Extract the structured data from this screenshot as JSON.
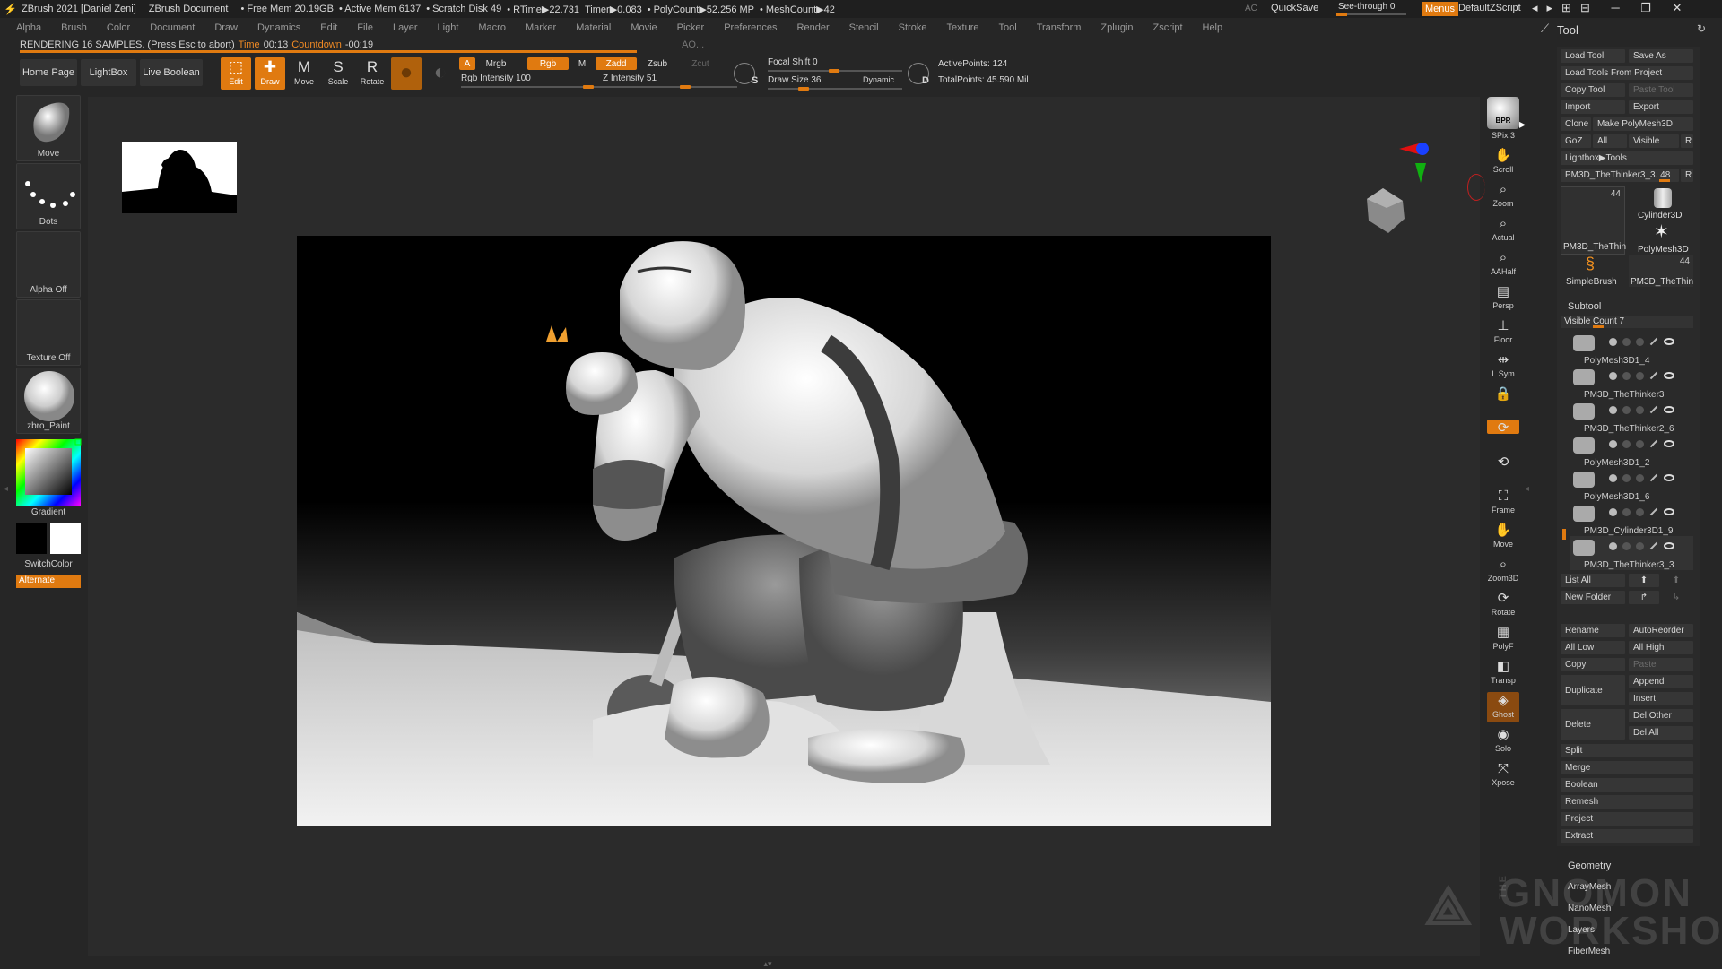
{
  "titlebar": {
    "app": "ZBrush 2021 [Daniel Zeni]",
    "document": "ZBrush Document",
    "free_mem": "• Free Mem 20.19GB",
    "active_mem": "• Active Mem 6137",
    "scratch": "• Scratch Disk 49",
    "rtime": "• RTime▶22.731",
    "timer": "Timer▶0.083",
    "polycount": "• PolyCount▶52.256 MP",
    "meshcount": "• MeshCount▶42",
    "ac": "AC",
    "quicksave": "QuickSave",
    "seethrough": "See-through  0",
    "menus": "Menus",
    "script": "DefaultZScript"
  },
  "menubar": [
    "Alpha",
    "Brush",
    "Color",
    "Document",
    "Draw",
    "Dynamics",
    "Edit",
    "File",
    "Layer",
    "Light",
    "Macro",
    "Marker",
    "Material",
    "Movie",
    "Picker",
    "Preferences",
    "Render",
    "Stencil",
    "Stroke",
    "Texture",
    "Tool",
    "Transform",
    "Zplugin",
    "Zscript",
    "Help"
  ],
  "status": {
    "rendering": "RENDERING 16 SAMPLES. (Press Esc to abort)",
    "time_label": "Time",
    "time": "00:13",
    "countdown_label": "Countdown",
    "countdown": "-00:19",
    "ao": "AO..."
  },
  "toolbar": {
    "home": "Home Page",
    "lightbox": "LightBox",
    "live_boolean": "Live Boolean",
    "edit": "Edit",
    "draw": "Draw",
    "move": "Move",
    "scale": "Scale",
    "rotate": "Rotate",
    "a": "A",
    "mrgb": "Mrgb",
    "rgb": "Rgb",
    "m": "M",
    "zadd": "Zadd",
    "zsub": "Zsub",
    "zcut": "Zcut",
    "rgb_intensity": "Rgb Intensity 100",
    "z_intensity": "Z Intensity 51",
    "focal_shift": "Focal Shift 0",
    "draw_size": "Draw Size 36",
    "dynamic": "Dynamic",
    "s": "S",
    "d": "D",
    "active_points": "ActivePoints: 124",
    "total_points": "TotalPoints: 45.590 Mil"
  },
  "left_shelf": {
    "move": "Move",
    "dots": "Dots",
    "alpha": "Alpha Off",
    "texture": "Texture Off",
    "material": "zbro_Paint",
    "gradient": "Gradient",
    "switchcolor": "SwitchColor",
    "alternate": "Alternate"
  },
  "right_icons": [
    "SPix 3",
    "Scroll",
    "Zoom",
    "Actual",
    "AAHalf",
    "Persp",
    "Floor",
    "L.Sym",
    "",
    "",
    "",
    "Frame",
    "Move",
    "Zoom3D",
    "Rotate",
    "PolyF",
    "Transp",
    "Ghost",
    "Solo",
    "Xpose"
  ],
  "bpr": "BPR",
  "tool_panel": {
    "title": "Tool",
    "load_tool": "Load Tool",
    "save_as": "Save As",
    "load_from_project": "Load Tools From Project",
    "copy_tool": "Copy Tool",
    "paste_tool": "Paste Tool",
    "import": "Import",
    "export": "Export",
    "clone": "Clone",
    "make_polymesh": "Make PolyMesh3D",
    "goz": "GoZ",
    "all": "All",
    "visible": "Visible",
    "r": "R",
    "lightbox_tools": "Lightbox▶Tools",
    "current_tool": "PM3D_TheThinker3_3. 48",
    "tool_thumbs": [
      {
        "label": "PM3D_TheThin",
        "count": "44"
      },
      {
        "label": "Cylinder3D",
        "count": ""
      },
      {
        "label": "PolyMesh3D",
        "count": ""
      },
      {
        "label": "SimpleBrush",
        "count": ""
      },
      {
        "label": "PM3D_TheThin",
        "count": "44"
      }
    ],
    "subtool": "Subtool",
    "visible_count": "Visible Count 7",
    "subtools": [
      "PolyMesh3D1_4",
      "PM3D_TheThinker3",
      "PM3D_TheThinker2_6",
      "PolyMesh3D1_2",
      "PolyMesh3D1_6",
      "PM3D_Cylinder3D1_9",
      "PM3D_TheThinker3_3"
    ],
    "list_all": "List All",
    "new_folder": "New Folder",
    "rename": "Rename",
    "autoreorder": "AutoReorder",
    "all_low": "All Low",
    "all_high": "All High",
    "copy": "Copy",
    "paste": "Paste",
    "duplicate": "Duplicate",
    "append": "Append",
    "insert": "Insert",
    "delete": "Delete",
    "del_other": "Del Other",
    "del_all": "Del All",
    "split": "Split",
    "merge": "Merge",
    "boolean": "Boolean",
    "remesh": "Remesh",
    "project": "Project",
    "extract": "Extract",
    "geometry": "Geometry",
    "arraymesh": "ArrayMesh",
    "nanomesh": "NanoMesh",
    "layers": "Layers",
    "fibermesh": "FiberMesh"
  },
  "watermark": [
    "THE",
    "GNOMON",
    "WORKSHOP"
  ],
  "colors": {
    "accent": "#e07a10",
    "panel": "#2a2a2a",
    "bg": "#262626"
  }
}
